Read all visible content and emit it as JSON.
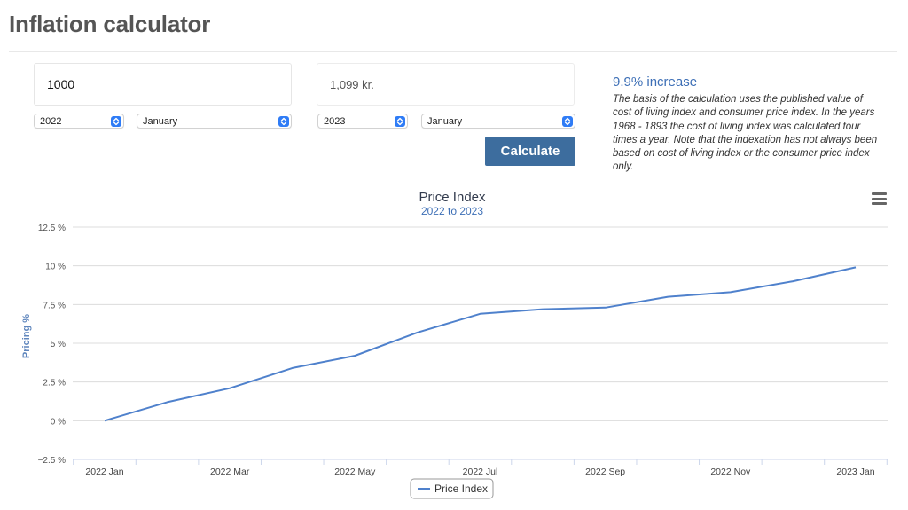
{
  "page": {
    "title": "Inflation calculator"
  },
  "form": {
    "amount_value": "1000",
    "result_value": "1,099 kr.",
    "from_year": "2022",
    "from_month": "January",
    "to_year": "2023",
    "to_month": "January",
    "calculate_label": "Calculate"
  },
  "summary": {
    "increase": "9.9% increase",
    "description": "The basis of the calculation uses the published value of cost of living index and consumer price index. In the years 1968 - 1893 the cost of living index was calculated four times a year. Note that the indexation has not always been based on cost of living index or the consumer price index only."
  },
  "colors": {
    "accent": "#3d6d9e",
    "link": "#3d6fb6",
    "series": "#4f81cc",
    "select_button": "#2f7cf6"
  },
  "icons": {
    "chart_menu": "hamburger-menu-icon",
    "select_arrows": "updown-chevron-icon"
  },
  "chart_data": {
    "type": "line",
    "title": "Price Index",
    "subtitle": "2022 to 2023",
    "ylabel": "Pricing %",
    "xlabel": "",
    "ylim": [
      -2.5,
      12.5
    ],
    "y_ticks": [
      -2.5,
      0,
      2.5,
      5,
      7.5,
      10,
      12.5
    ],
    "y_tick_labels": [
      "−2.5 %",
      "0 %",
      "2.5 %",
      "5 %",
      "7.5 %",
      "10 %",
      "12.5 %"
    ],
    "x_tick_labels": [
      "2022 Jan",
      "2022 Mar",
      "2022 May",
      "2022 Jul",
      "2022 Sep",
      "2022 Nov",
      "2023 Jan"
    ],
    "categories": [
      "2022 Jan",
      "2022 Feb",
      "2022 Mar",
      "2022 Apr",
      "2022 May",
      "2022 Jun",
      "2022 Jul",
      "2022 Aug",
      "2022 Sep",
      "2022 Oct",
      "2022 Nov",
      "2022 Dec",
      "2023 Jan"
    ],
    "series": [
      {
        "name": "Price Index",
        "values": [
          0,
          1.2,
          2.1,
          3.4,
          4.2,
          5.7,
          6.9,
          7.2,
          7.3,
          8.0,
          8.3,
          9.0,
          9.9
        ]
      }
    ],
    "grid": true,
    "legend": "bottom-center"
  }
}
